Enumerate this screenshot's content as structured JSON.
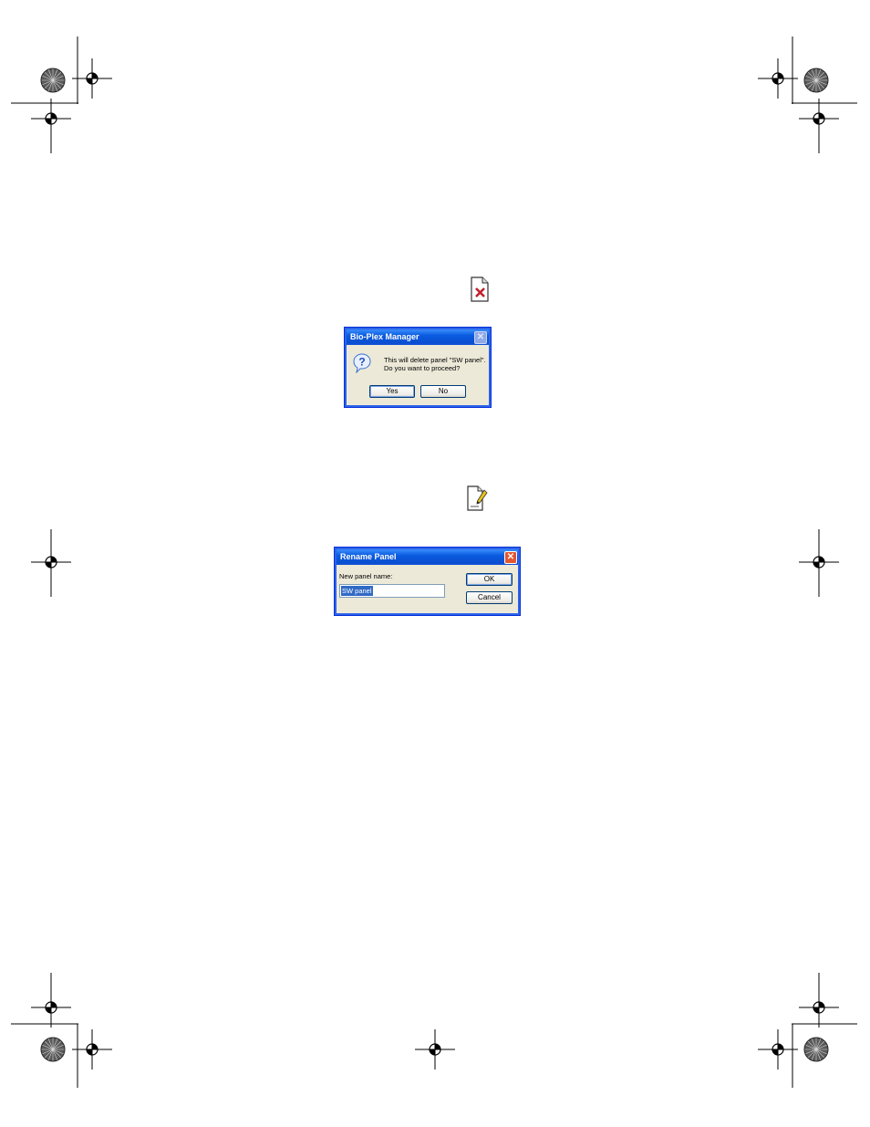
{
  "toolbar_icons": [
    {
      "name": "delete-panel-icon",
      "glyph": "✕",
      "color": "#C0202A"
    },
    {
      "name": "rename-panel-icon",
      "glyph": "✎",
      "color": "#C9A000"
    }
  ],
  "delete_dialog": {
    "title": "Bio-Plex Manager",
    "message_line1": "This will delete panel \"SW panel\".",
    "message_line2": "Do you want to proceed?",
    "yes_label": "Yes",
    "no_label": "No",
    "icon": "question-icon"
  },
  "rename_dialog": {
    "title": "Rename Panel",
    "field_label": "New panel name:",
    "field_value": "SW panel",
    "ok_label": "OK",
    "cancel_label": "Cancel"
  },
  "colors": {
    "xp_title_blue": "#0A5BE0",
    "dialog_bg": "#ECE9D8",
    "selection": "#316AC5",
    "close_red": "#E3562F"
  }
}
